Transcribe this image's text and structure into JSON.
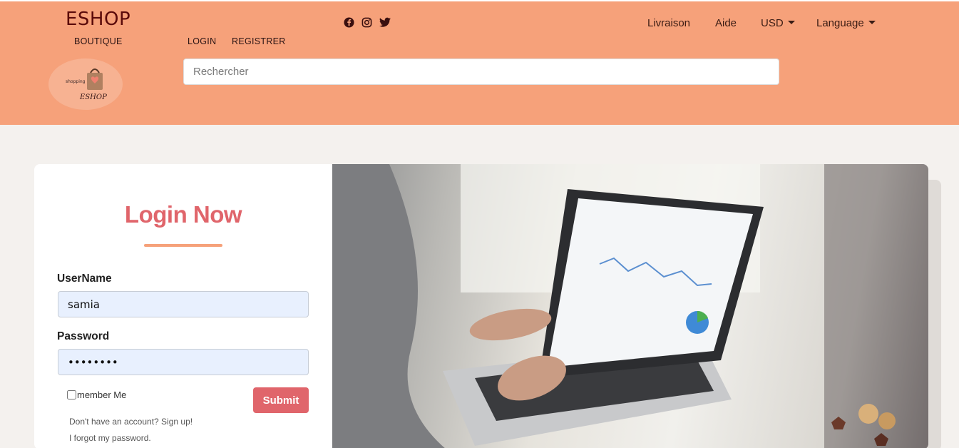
{
  "header": {
    "brand": "ESHOP",
    "boutique": "BOUTIQUE",
    "login": "LOGIN",
    "register": "REGISTRER",
    "logo_text": "ESHOP",
    "logo_small": "shopping",
    "search_placeholder": "Rechercher",
    "nav": {
      "delivery": "Livraison",
      "help": "Aide",
      "currency": "USD",
      "language": "Language"
    },
    "social_icons": [
      "facebook-icon",
      "instagram-icon",
      "twitter-icon"
    ]
  },
  "login": {
    "title": "Login Now",
    "username_label": "UserName",
    "username_value": "samia",
    "password_label": "Password",
    "password_value": "••••••••",
    "remember_label": "member Me",
    "submit_label": "Submit",
    "signup_text": "Don't have an account? Sign up!",
    "forgot_text": "I forgot my password."
  },
  "colors": {
    "header_bg": "#f6a17a",
    "accent": "#e0656b",
    "page_bg": "#f4f1ee"
  }
}
